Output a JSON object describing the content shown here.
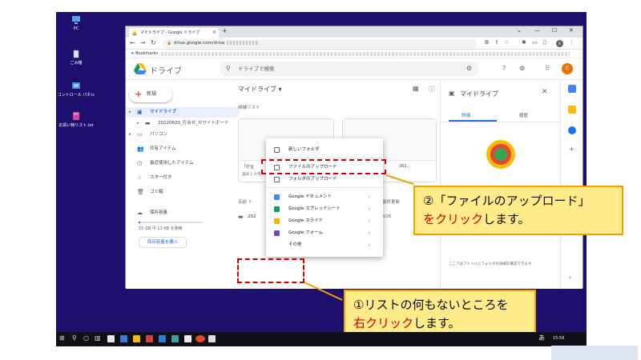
{
  "desktop": {
    "icons": [
      {
        "label": "PC"
      },
      {
        "label": "ごみ箱"
      },
      {
        "label": "コントロール パネル"
      },
      {
        "label": "お買い物リスト.txt"
      }
    ]
  },
  "browser": {
    "tab_title": "マイドライブ - Google ドライブ",
    "tab_close": "×",
    "new_tab": "+",
    "window_controls": [
      "⌄",
      "—",
      "☐",
      "✕"
    ],
    "url_text": "drive.google.com/drive",
    "bookmarks_label": "Bookmarks",
    "profile_initial": "B"
  },
  "drive": {
    "app_name": "ドライブ",
    "search_placeholder": "ドライブで検索",
    "user_initial": "C",
    "new_button": "新規",
    "nav": [
      {
        "label": "マイドライブ"
      },
      {
        "label": "20220620_打合せ_ホワイトボード"
      },
      {
        "label": "パソコン"
      },
      {
        "label": "共有アイテム"
      },
      {
        "label": "最近使用したアイテム"
      },
      {
        "label": "スター付き"
      },
      {
        "label": "ゴミ箱"
      },
      {
        "label": "保存容量"
      }
    ],
    "storage_text": "15 GB 中 13 KB を使用",
    "storage_fraction": 0.01,
    "buy_storage": "保存容量を購入",
    "main_title": "マイドライブ",
    "main_title_caret": "▾",
    "suggested_header": "候補リスト",
    "card_left_name": "「打合",
    "card_left_meta": "過去 1 か月",
    "card_right_name": "202...",
    "col_name": "名前 ↑",
    "col_modified": "最終更新",
    "row_name": "202",
    "row_date": "6/26",
    "details_title": "マイドライブ",
    "details_tab_details": "詳細",
    "details_tab_activity": "履歴",
    "details_message": "ここではファイルとフォルダの詳細を確認できます",
    "rail_plus": "+",
    "rail_next": "›"
  },
  "context_menu": {
    "items": [
      {
        "label": "新しいフォルダ"
      },
      {
        "label": "ファイルのアップロード"
      },
      {
        "label": "フォルダのアップロード"
      },
      {
        "label": "Google ドキュメント"
      },
      {
        "label": "Google スプレッドシート"
      },
      {
        "label": "Google スライド"
      },
      {
        "label": "Google フォーム"
      },
      {
        "label": "その他"
      }
    ],
    "submenu_arrow": "›"
  },
  "callouts": {
    "step2_line1_num": "②",
    "step2_line1_q": "「ファイルのアップロード」",
    "step2_line2_em": "をクリック",
    "step2_line2_tail": "します。",
    "step1_line1": "①リストの何もないところを",
    "step1_line2_em": "右クリック",
    "step1_line2_tail": "します。"
  },
  "taskbar": {
    "kana": "あ",
    "time": "15:56"
  },
  "colors": {
    "desktop": "#1c0f6e",
    "accent": "#1a73e8",
    "highlight": "#d00000",
    "callout_bg": "#ffeb8a",
    "callout_border": "#f0a000"
  }
}
